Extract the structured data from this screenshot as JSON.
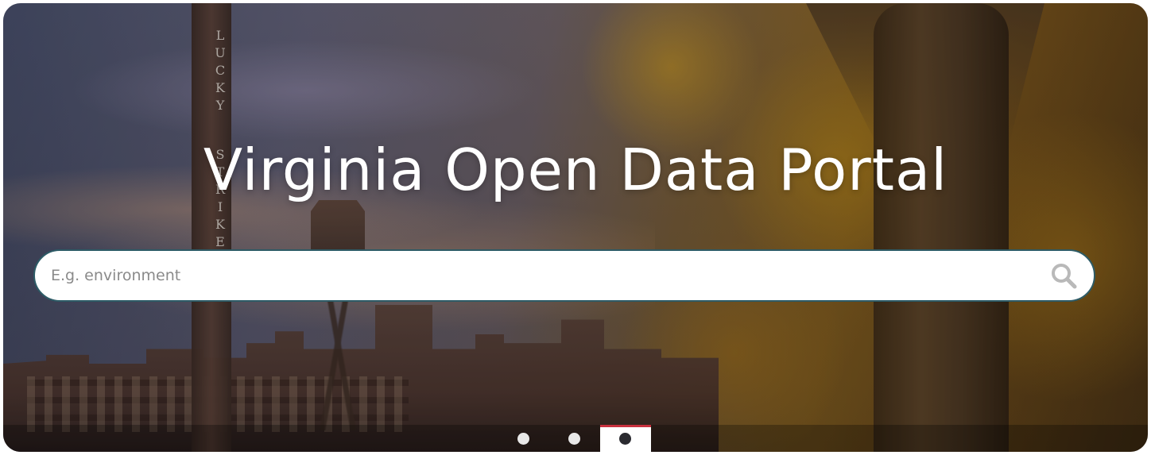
{
  "hero": {
    "title": "Virginia Open Data Portal",
    "stack_letters": [
      "L",
      "U",
      "C",
      "K",
      "Y",
      "S",
      "T",
      "R",
      "I",
      "K",
      "E"
    ]
  },
  "search": {
    "placeholder": "E.g. environment",
    "value": "",
    "icon": "search-icon"
  },
  "carousel": {
    "slide_count": 3,
    "active_index": 2,
    "active_accent": "#c8313e"
  },
  "colors": {
    "search_border": "#2d5b66",
    "title_text": "#ffffff"
  }
}
